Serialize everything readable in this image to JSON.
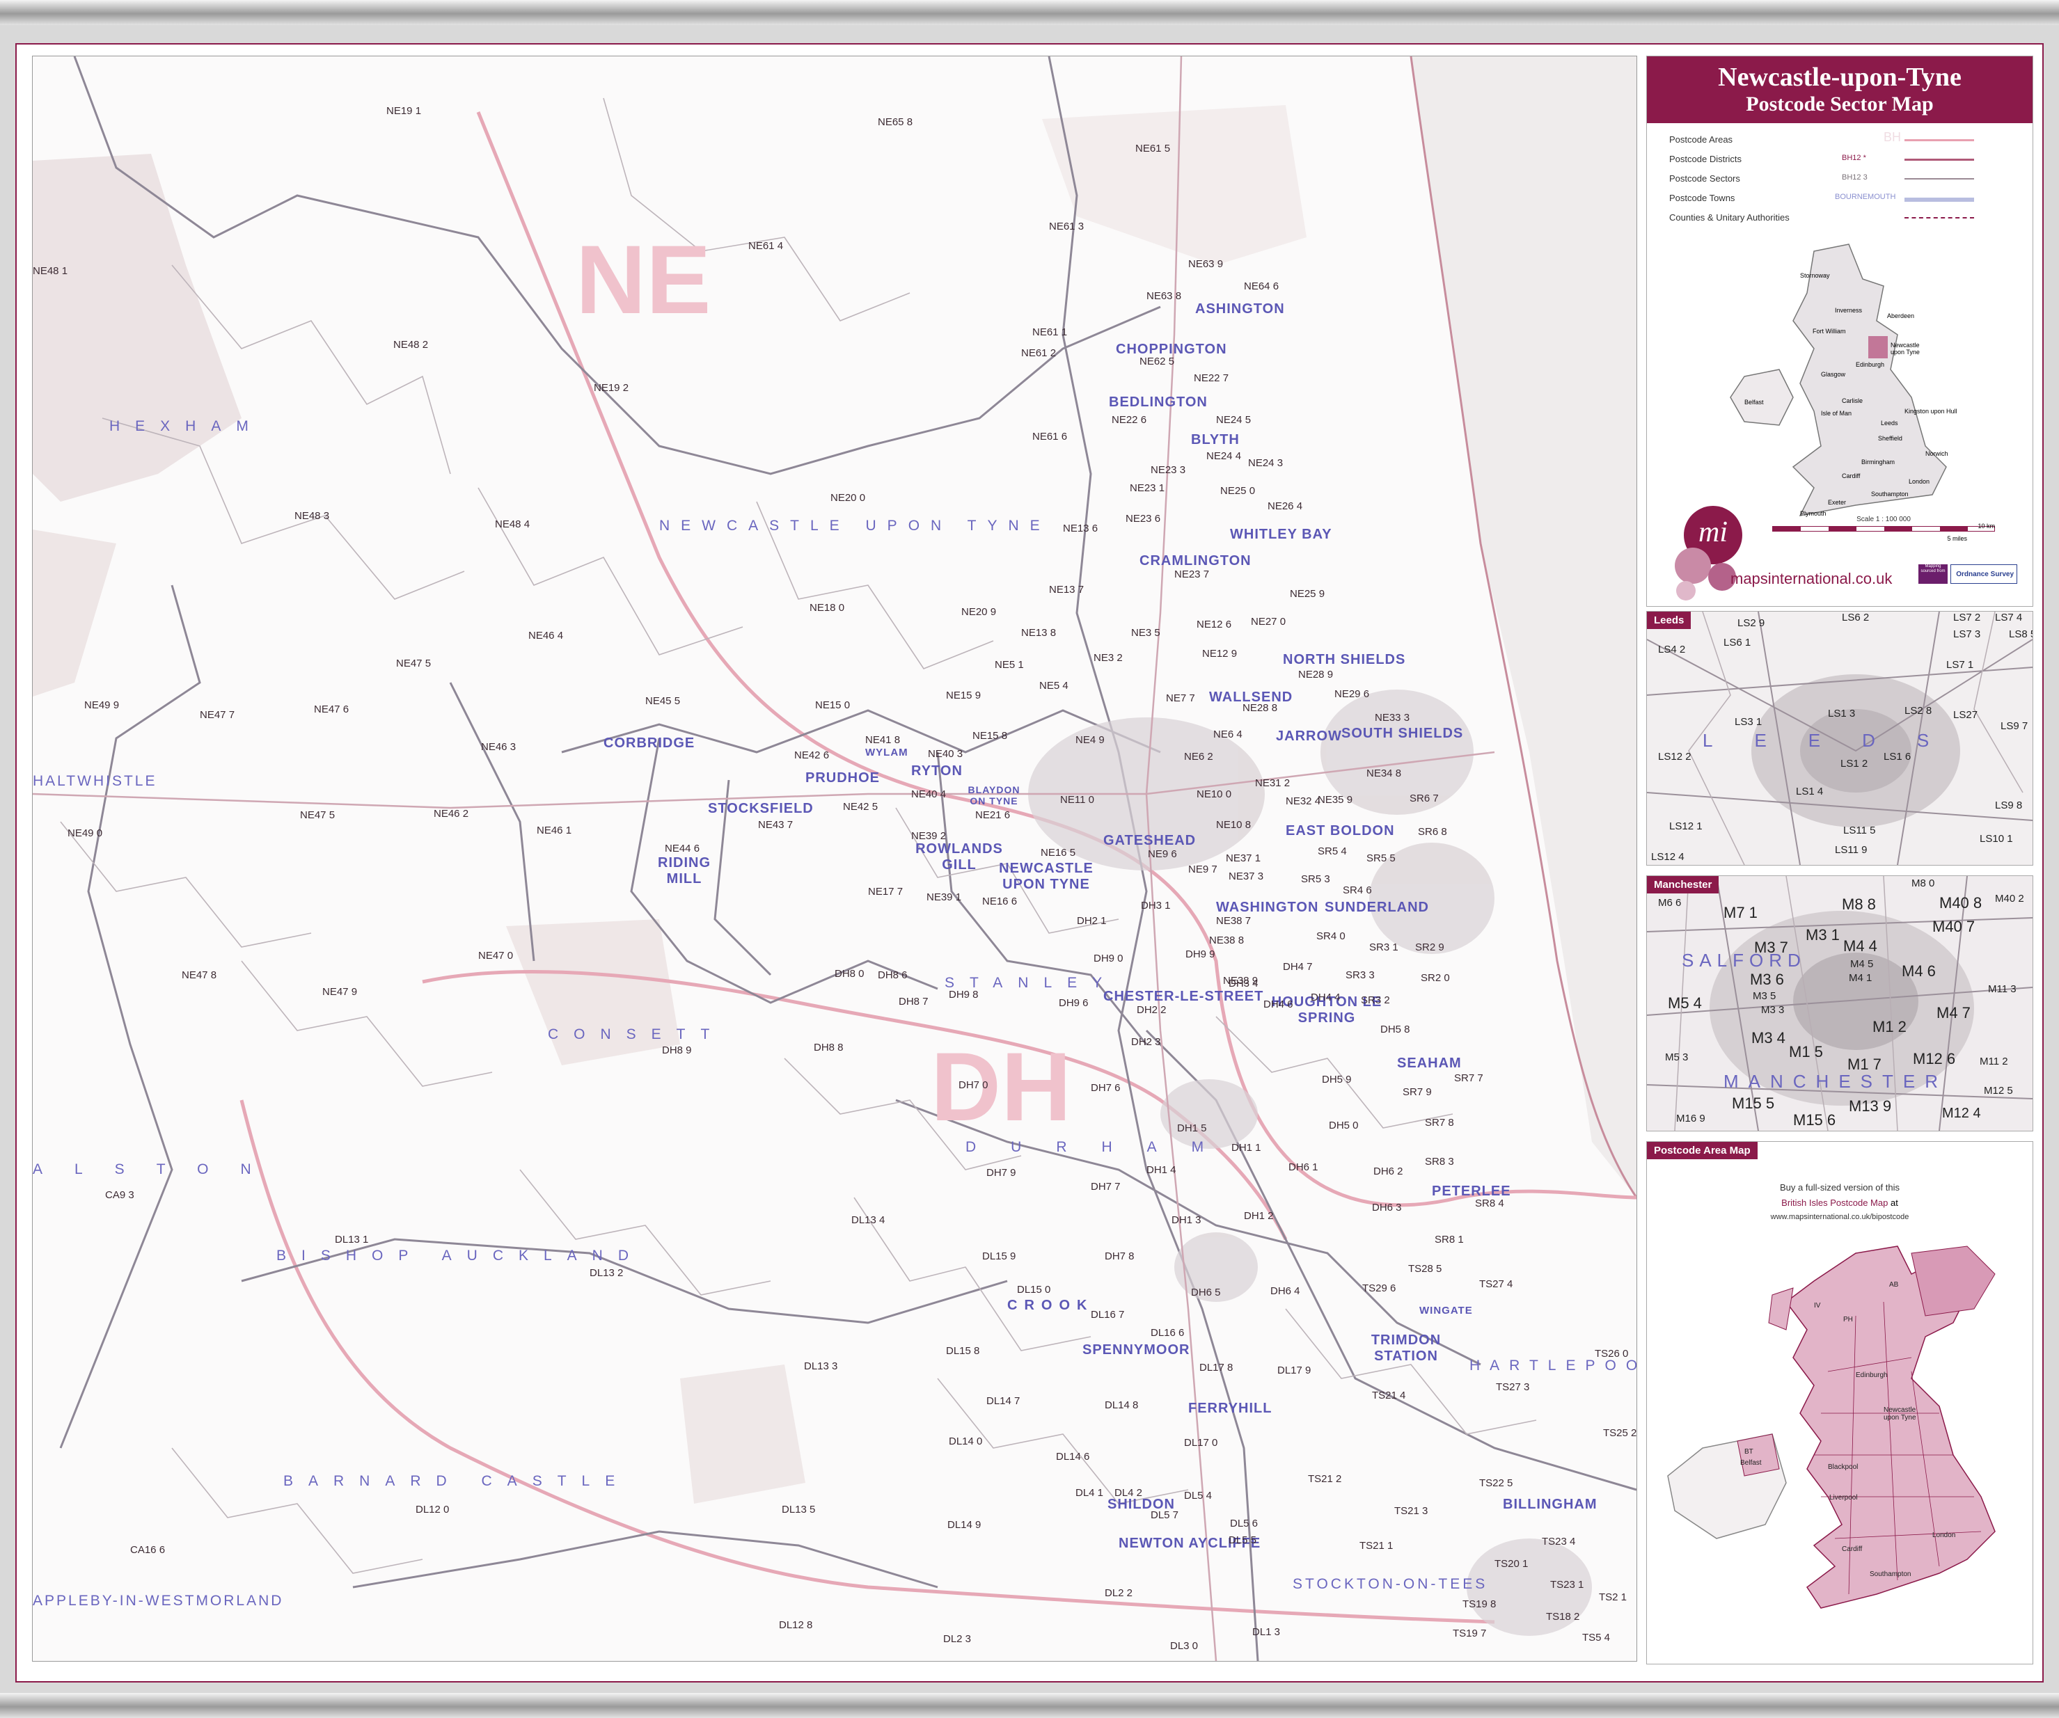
{
  "title": {
    "line1": "Newcastle-upon-Tyne",
    "line2": "Postcode Sector Map"
  },
  "legend": [
    {
      "label": "Postcode Areas",
      "sample": "BH",
      "color": "#e8a0b0"
    },
    {
      "label": "Postcode Districts",
      "sample": "BH12 *",
      "color": "#b05a78"
    },
    {
      "label": "Postcode Sectors",
      "sample": "BH12 3",
      "color": "#9a8a94"
    },
    {
      "label": "Postcode Towns",
      "sample": "BOURNEMOUTH",
      "color": "#b8bde0"
    },
    {
      "label": "Counties & Unitary Authorities",
      "sample": "",
      "color": "#8b1a4a"
    }
  ],
  "scale": {
    "label": "Scale 1 : 100 000",
    "km": "10 km",
    "miles": "5 miles"
  },
  "brand": {
    "logo_text": "mi",
    "site": "mapsinternational.co.uk",
    "os_text": "Ordnance Survey",
    "os_sub": "Mapping sourced from"
  },
  "overview_labels": [
    "Stornoway",
    "Inverness",
    "Aberdeen",
    "Fort William",
    "Edinburgh",
    "Glasgow",
    "Newcastle upon Tyne",
    "Belfast",
    "Carlisle",
    "Leeds",
    "Kingston upon Hull",
    "Sheffield",
    "Birmingham",
    "Norwich",
    "London",
    "Southampton",
    "Exeter",
    "Plymouth",
    "Cardiff",
    "Isle of Man"
  ],
  "map": {
    "area_letters": [
      {
        "text": "NE"
      },
      {
        "text": "DH"
      }
    ],
    "big_towns": [
      {
        "text": "HEXHAM"
      },
      {
        "text": "NEWCASTLE UPON TYNE"
      },
      {
        "text": "CONSETT"
      },
      {
        "text": "STANLEY"
      },
      {
        "text": "DURHAM"
      },
      {
        "text": "BISHOP AUCKLAND"
      },
      {
        "text": "BARNARD CASTLE"
      },
      {
        "text": "ALSTON"
      },
      {
        "text": "HARTLEPOOL"
      },
      {
        "text": "APPLEBY-IN-WESTMORLAND"
      },
      {
        "text": "HALTWHISTLE"
      },
      {
        "text": "STOCKTON-ON-TEES"
      }
    ],
    "towns": [
      "ASHINGTON",
      "CHOPPINGTON",
      "BEDLINGTON",
      "BLYTH",
      "CRAMLINGTON",
      "WHITLEY BAY",
      "NORTH SHIELDS",
      "SOUTH SHIELDS",
      "WALLSEND",
      "JARROW",
      "GATESHEAD",
      "EAST BOLDON",
      "WASHINGTON",
      "SUNDERLAND",
      "CHESTER-LE-STREET",
      "HOUGHTON LE SPRING",
      "SEAHAM",
      "PETERLEE",
      "CORBRIDGE",
      "PRUDHOE",
      "WYLAM",
      "RYTON",
      "BLAYDON ON TYNE",
      "STOCKSFIELD",
      "RIDING MILL",
      "ROWLANDS GILL",
      "NEWCASTLE UPON TYNE",
      "CROOK",
      "SPENNYMOOR",
      "FERRYHILL",
      "TRIMDON STATION",
      "WINGATE",
      "SHILDON",
      "NEWTON AYCLIFFE",
      "BILLINGHAM"
    ],
    "sectors": [
      "NE19 1",
      "NE65 8",
      "NE61 5",
      "NE61 3",
      "NE61 4",
      "NE63 9",
      "NE64 6",
      "NE63 8",
      "NE61 1",
      "NE61 2",
      "NE62 5",
      "NE22 7",
      "NE22 6",
      "NE24 5",
      "NE24 4",
      "NE24 3",
      "NE23 3",
      "NE23 1",
      "NE25 0",
      "NE26 4",
      "NE23 6",
      "NE23 7",
      "NE48 1",
      "NE48 2",
      "NE19 2",
      "NE61 6",
      "NE20 0",
      "NE13 6",
      "NE48 3",
      "NE48 4",
      "NE18 0",
      "NE13 7",
      "NE20 9",
      "NE25 9",
      "NE27 0",
      "NE12 6",
      "NE46 4",
      "NE47 5",
      "NE13 8",
      "NE3 5",
      "NE12 9",
      "NE3 2",
      "NE5 1",
      "NE28 9",
      "NE29 6",
      "NE49 9",
      "NE47 7",
      "NE47 6",
      "NE45 5",
      "NE15 0",
      "NE15 9",
      "NE5 4",
      "NE7 7",
      "NE28 8",
      "NE33 3",
      "NE46 3",
      "NE42 6",
      "NE41 8",
      "NE40 3",
      "NE15 8",
      "NE4 9",
      "NE6 2",
      "NE6 4",
      "NE34 8",
      "NE49 0",
      "NE47 5",
      "NE46 2",
      "NE46 1",
      "NE43 7",
      "NE42 5",
      "NE40 4",
      "NE21 6",
      "NE11 0",
      "NE10 0",
      "NE31 2",
      "NE32 4",
      "NE35 9",
      "SR6 7",
      "NE44 6",
      "NE39 2",
      "NE16 5",
      "NE10 8",
      "NE9 6",
      "NE9 7",
      "NE37 1",
      "SR5 4",
      "SR5 5",
      "SR6 8",
      "NE47 8",
      "NE47 9",
      "NE47 0",
      "NE17 7",
      "NE39 1",
      "NE16 6",
      "NE37 3",
      "SR5 3",
      "SR4 6",
      "DH3 1",
      "DH9 9",
      "DH9 0",
      "DH2 1",
      "NE38 7",
      "NE38 8",
      "SR4 0",
      "SR3 1",
      "SR2 9",
      "NE38 9",
      "DH8 0",
      "DH8 6",
      "DH9 8",
      "DH9 6",
      "DH2 2",
      "DH3 4",
      "DH4 7",
      "SR3 3",
      "SR2 0",
      "DH8 7",
      "DH4 6",
      "DH4 4",
      "SR3 2",
      "DH8 9",
      "DH8 8",
      "DH2 3",
      "DH5 8",
      "DH7 0",
      "DH7 6",
      "DH5 9",
      "SR7 7",
      "SR7 9",
      "SR7 8",
      "DH5 0",
      "CA9 3",
      "DH1 5",
      "DH1 1",
      "DH7 9",
      "DH1 4",
      "DH6 1",
      "DH6 2",
      "SR8 3",
      "DH7 7",
      "SR8 4",
      "DL13 4",
      "DH1 3",
      "DH1 2",
      "DL13 1",
      "DH6 3",
      "SR8 1",
      "DL13 2",
      "DL15 9",
      "DH7 8",
      "TS28 5",
      "TS29 6",
      "TS27 4",
      "DL15 0",
      "DH6 5",
      "DH6 4",
      "DL16 7",
      "DL15 8",
      "DL16 6",
      "TS26 0",
      "DL13 3",
      "DL17 8",
      "DL17 9",
      "TS27 3",
      "DL14 7",
      "DL14 8",
      "TS21 4",
      "DL14 0",
      "DL17 0",
      "DL14 6",
      "TS25 2",
      "DL14 9",
      "DL4 1",
      "DL4 2",
      "DL5 4",
      "TS21 2",
      "TS22 5",
      "DL12 0",
      "DL13 5",
      "DL5 7",
      "DL5 6",
      "DL5 5",
      "TS21 3",
      "CA16 6",
      "TS21 1",
      "TS23 4",
      "TS20 1",
      "DL2 2",
      "TS19 8",
      "TS23 1",
      "TS2 1",
      "DL12 8",
      "DL2 3",
      "DL3 0",
      "DL1 3",
      "TS19 7",
      "TS18 2",
      "TS5 4"
    ]
  },
  "leeds_inset": {
    "title": "Leeds",
    "town": "LEEDS",
    "labels": [
      "LS2 9",
      "LS6 2",
      "LS7 2",
      "LS7 4",
      "LS4 2",
      "LS6 1",
      "LS7 3",
      "LS8 5",
      "LS7 1",
      "LS2 8",
      "LS27",
      "LS3 1",
      "LS1 3",
      "LS9 7",
      "LS12 2",
      "LS1 2",
      "LS1 6",
      "LS1 4",
      "LS9 8",
      "LS12 1",
      "LS11 5",
      "LS10 1",
      "LS11 9",
      "LS12 4"
    ]
  },
  "manchester_inset": {
    "title": "Manchester",
    "towns": [
      "SALFORD",
      "MANCHESTER"
    ],
    "labels": [
      "M6 6",
      "M7 1",
      "M8 8",
      "M8 0",
      "M40 8",
      "M40 2",
      "M40 7",
      "M3 7",
      "M3 1",
      "M4 4",
      "M3 6",
      "M4 5",
      "M4 1",
      "M4 6",
      "M11 3",
      "M5 4",
      "M3 5",
      "M3 3",
      "M1 2",
      "M4 7",
      "M3 4",
      "M5 3",
      "M1 5",
      "M1 7",
      "M12 6",
      "M11 2",
      "M15 5",
      "M13 9",
      "M12 5",
      "M16 9",
      "M15 6",
      "M12 4"
    ]
  },
  "area_map": {
    "title": "Postcode Area Map",
    "buy_text": "Buy a full-sized version of this",
    "product": "British Isles Postcode Map",
    "at": "at",
    "url": "www.mapsinternational.co.uk/bipostcode",
    "labels": [
      "AB",
      "PH",
      "IV",
      "Edinburgh",
      "Newcastle upon Tyne",
      "BT",
      "Belfast",
      "Blackpool",
      "Liverpool",
      "London",
      "Cardiff",
      "Southampton"
    ]
  },
  "colors": {
    "brand": "#8b1a4a",
    "town_text": "#5b57b5",
    "area_text": "#f0c2cc",
    "pink_region": "#e2b4c8",
    "district_line": "#8e8796",
    "area_line": "#e6a8b6"
  }
}
